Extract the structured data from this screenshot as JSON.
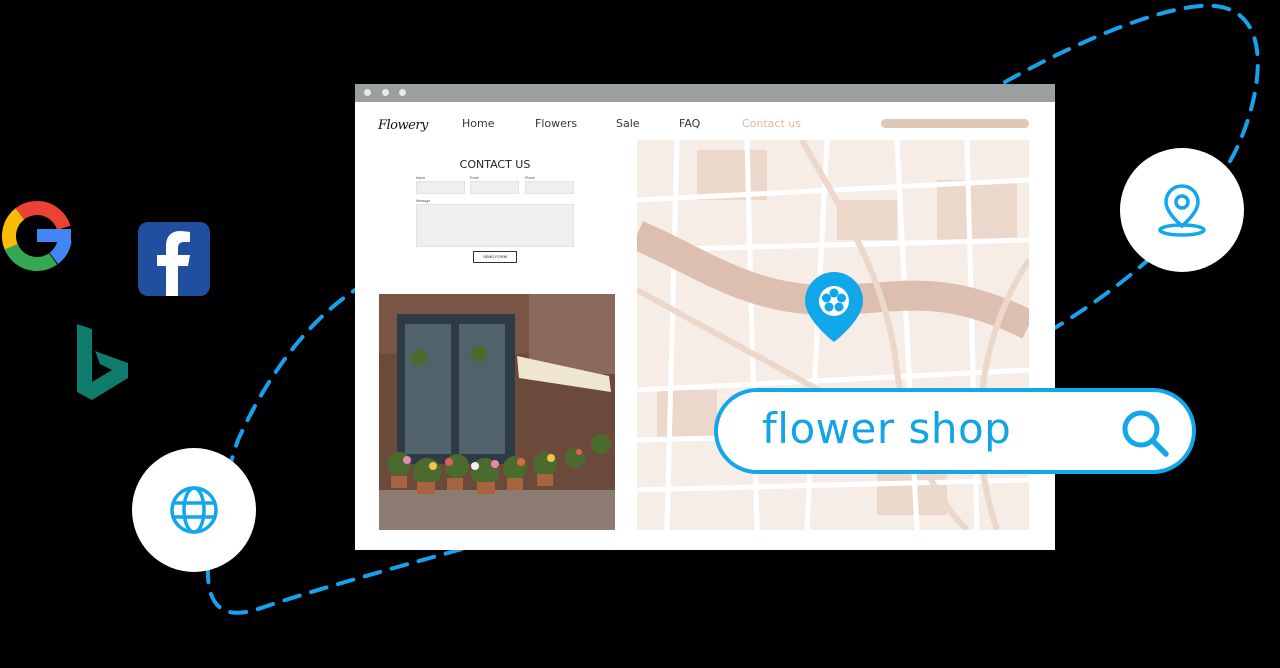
{
  "brand": {
    "logo": "Flowery"
  },
  "nav": [
    {
      "label": "Home"
    },
    {
      "label": "Flowers"
    },
    {
      "label": "Sale"
    },
    {
      "label": "FAQ"
    },
    {
      "label": "Contact us",
      "active": true
    }
  ],
  "contact": {
    "title": "CONTACT US",
    "fields": {
      "name": "Name",
      "email": "Email",
      "phone": "Phone",
      "message": "Message"
    },
    "submit": "SEND FORM"
  },
  "search": {
    "query": "flower shop"
  },
  "icons": [
    "google-icon",
    "facebook-icon",
    "bing-icon",
    "globe-icon",
    "location-pin-icon",
    "search-icon",
    "flower-map-pin-icon"
  ],
  "colors": {
    "accent": "#11a7ea",
    "map_road": "#dcbfae",
    "map_bg": "#f7ede7"
  }
}
